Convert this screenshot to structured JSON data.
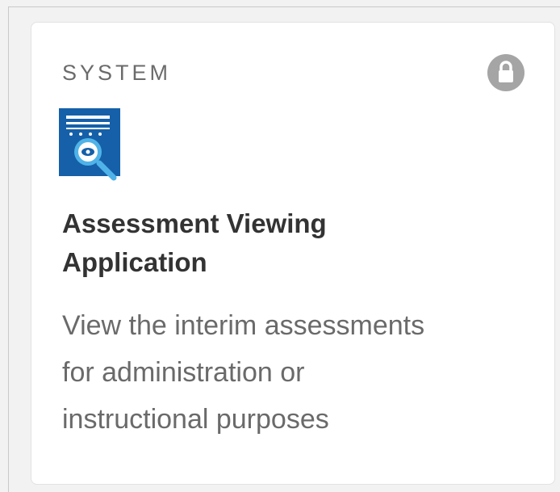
{
  "card": {
    "category": "SYSTEM",
    "title_line1": "Assessment Viewing",
    "title_line2": "Application",
    "description_line1": "View the interim assessments",
    "description_line2": "for administration or",
    "description_line3": "instructional purposes",
    "lock_icon": "lock-icon",
    "app_icon": "assessment-document-search-icon"
  },
  "colors": {
    "background": "#f2f2f2",
    "card": "#ffffff",
    "icon_blue": "#1560a8",
    "icon_accent": "#4fb3e8",
    "lock_gray": "#a5a5a5",
    "title_text": "#333333",
    "body_text": "#6a6a6a"
  }
}
